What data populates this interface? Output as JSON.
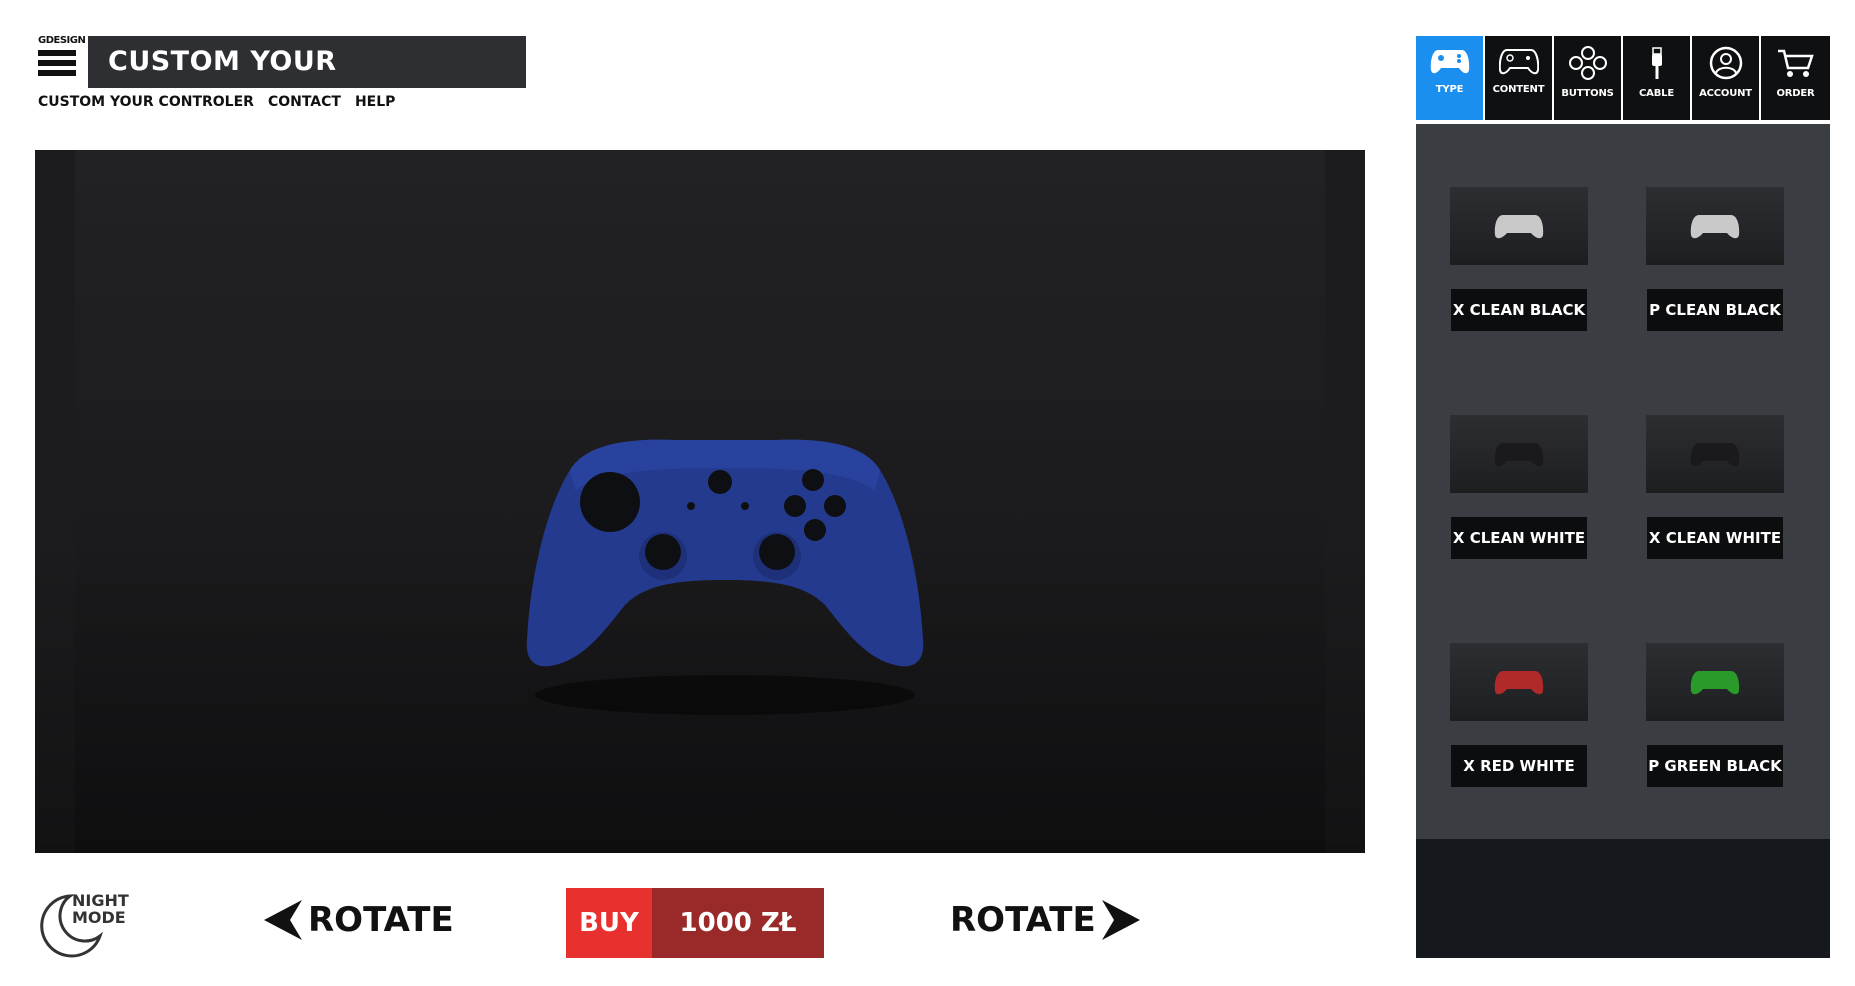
{
  "brand": {
    "name": "GDESIGN"
  },
  "header": {
    "title": "CUSTOM YOUR CONTROLER"
  },
  "topnav": {
    "items": [
      "CUSTOM YOUR CONTROLER",
      "CONTACT",
      "HELP"
    ]
  },
  "viewer": {
    "controller_color": "#243a8e",
    "background_color": "#1e1e20"
  },
  "bottom": {
    "night_mode_line1": "NIGHT",
    "night_mode_line2": "MODE",
    "rotate_left_label": "ROTATE",
    "rotate_right_label": "ROTATE",
    "buy_label": "BUY",
    "price": "1000 ZŁ"
  },
  "tabs": [
    {
      "label": "TYPE",
      "icon": "gamepad-icon",
      "active": true
    },
    {
      "label": "CONTENT",
      "icon": "gamepad-outline-icon",
      "active": false
    },
    {
      "label": "BUTTONS",
      "icon": "buttons-icon",
      "active": false
    },
    {
      "label": "CABLE",
      "icon": "cable-icon",
      "active": false
    },
    {
      "label": "ACCOUNT",
      "icon": "account-icon",
      "active": false
    },
    {
      "label": "ORDER",
      "icon": "cart-icon",
      "active": false
    }
  ],
  "options": [
    {
      "label": "X CLEAN BLACK",
      "color": "#c9c9c9"
    },
    {
      "label": "P CLEAN BLACK",
      "color": "#c9c9c9"
    },
    {
      "label": "X CLEAN WHITE",
      "color": "#1a1a1c"
    },
    {
      "label": "X CLEAN WHITE",
      "color": "#1a1a1c"
    },
    {
      "label": "X RED WHITE",
      "color": "#b02a2a"
    },
    {
      "label": "P GREEN BLACK",
      "color": "#2a9a2a"
    }
  ],
  "colors": {
    "accent": "#1a8ff0",
    "buy": "#e8312f",
    "price": "#9a2a2a",
    "panel": "#3a3d42",
    "title_bg": "#2d2f32"
  }
}
